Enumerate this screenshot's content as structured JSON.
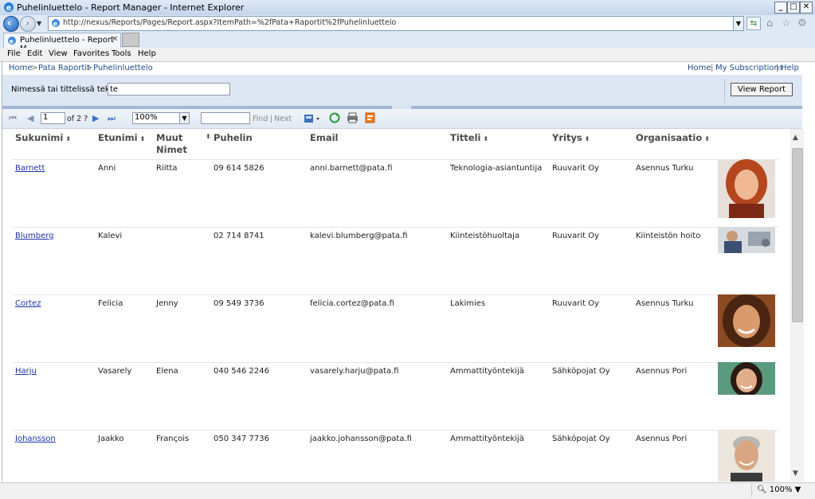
{
  "window": {
    "title": "Puhelinluettelo - Report Manager - Internet Explorer"
  },
  "browser": {
    "url": "http://nexus/Reports/Pages/Report.aspx?ItemPath=%2fPata+Raportit%2fPuhelinluettelo",
    "tab_title": "Puhelinluettelo - Report M...",
    "zoom": "100%"
  },
  "menu": [
    "File",
    "Edit",
    "View",
    "Favorites",
    "Tools",
    "Help"
  ],
  "breadcrumb": {
    "home": "Home",
    "sep": ">",
    "folder": "Pata Raportit",
    "current": "Puhelinluettelo"
  },
  "toplinks": {
    "home": "Home",
    "subscriptions": "My Subscriptions",
    "help": "Help",
    "sep": "|"
  },
  "params": {
    "label": "Nimessä tai tittelissä teksti",
    "value": "te",
    "view_report": "View Report"
  },
  "toolbar": {
    "page": "1",
    "of_pages": "of 2 ?",
    "zoom": "100%",
    "find": "Find",
    "sep": "|",
    "next": "Next"
  },
  "report": {
    "columns": [
      "Sukunimi",
      "Etunimi",
      "Muut",
      "Nimet",
      "Puhelin",
      "Email",
      "Titteli",
      "Yritys",
      "Organisaatio"
    ],
    "rows": [
      {
        "sukunimi": "Barnett",
        "etunimi": "Anni",
        "muut": "Riitta",
        "puhelin": "09 614 5826",
        "email": "anni.barnett@pata.fi",
        "titteli": "Teknologia-asiantuntija",
        "yritys": "Ruuvarit Oy",
        "organisaatio": "Asennus Turku"
      },
      {
        "sukunimi": "Blumberg",
        "etunimi": "Kalevi",
        "muut": "",
        "puhelin": "02 714 8741",
        "email": "kalevi.blumberg@pata.fi",
        "titteli": "Kiinteistöhuoltaja",
        "yritys": "Ruuvarit Oy",
        "organisaatio": "Kiinteistön hoito"
      },
      {
        "sukunimi": "Cortez",
        "etunimi": "Felicia",
        "muut": "Jenny",
        "puhelin": "09 549 3736",
        "email": "felicia.cortez@pata.fi",
        "titteli": "Lakimies",
        "yritys": "Ruuvarit Oy",
        "organisaatio": "Asennus Turku"
      },
      {
        "sukunimi": "Harju",
        "etunimi": "Vasarely",
        "muut": "Elena",
        "puhelin": "040 546 2246",
        "email": "vasarely.harju@pata.fi",
        "titteli": "Ammattityöntekijä",
        "yritys": "Sähköpojat Oy",
        "organisaatio": "Asennus Pori"
      },
      {
        "sukunimi": "Johansson",
        "etunimi": "Jaakko",
        "muut": "François",
        "puhelin": "050 347 7736",
        "email": "jaakko.johansson@pata.fi",
        "titteli": "Ammattityöntekijä",
        "yritys": "Sähköpojat Oy",
        "organisaatio": "Asennus Pori"
      }
    ]
  },
  "colors": {
    "link": "#1c34a8",
    "param_bg": "#dde7f3",
    "splitter": "#a3b7d6"
  }
}
